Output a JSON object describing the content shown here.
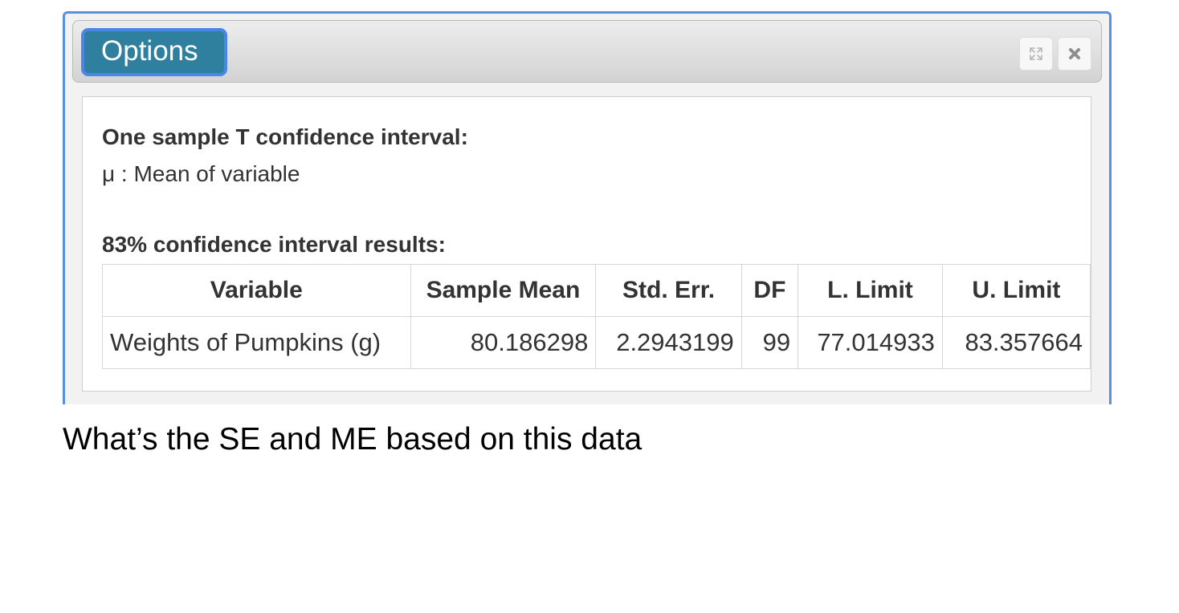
{
  "window": {
    "options_label": "Options",
    "maximize_icon": "expand-icon",
    "close_icon": "close-icon"
  },
  "output": {
    "title": "One sample T confidence interval:",
    "parameter": "μ : Mean of variable",
    "results_heading": "83% confidence interval results:",
    "table": {
      "headers": [
        "Variable",
        "Sample Mean",
        "Std. Err.",
        "DF",
        "L. Limit",
        "U. Limit"
      ],
      "rows": [
        [
          "Weights of Pumpkins (g)",
          "80.186298",
          "2.2943199",
          "99",
          "77.014933",
          "83.357664"
        ]
      ]
    }
  },
  "question": "What’s the SE and ME based on this data",
  "colors": {
    "panel_border": "#5b8fe0",
    "options_button_bg": "#2f7f9e",
    "options_button_border": "#4a86e8"
  }
}
